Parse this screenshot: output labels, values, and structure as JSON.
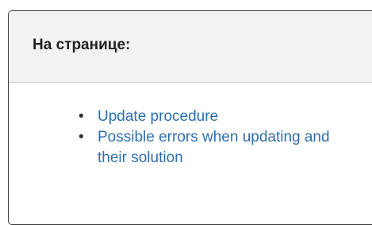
{
  "panel": {
    "title": "На странице:",
    "items": [
      {
        "label": "Update procedure"
      },
      {
        "label": "Possible errors when updating and their solution"
      }
    ]
  },
  "colors": {
    "link": "#2f6fae",
    "header_bg": "#f2f2f2",
    "border": "#3a3a3a"
  }
}
